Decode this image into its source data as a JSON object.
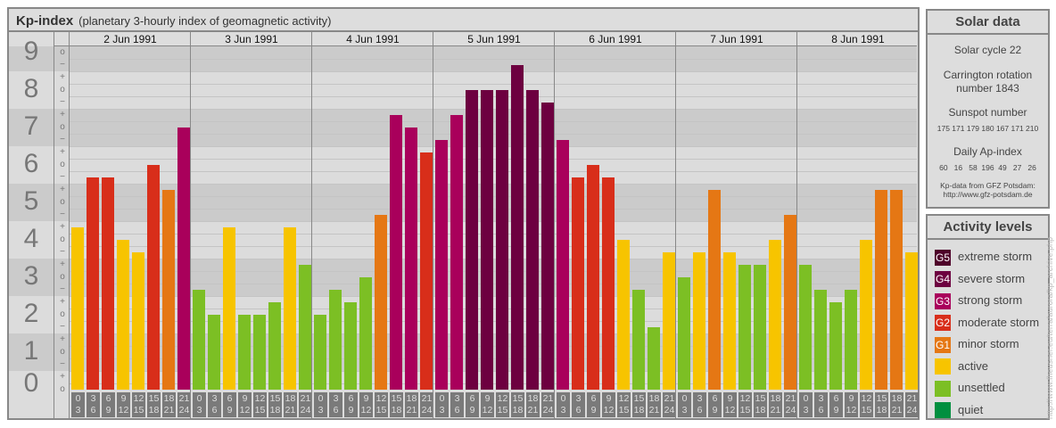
{
  "header": {
    "title": "Kp-index",
    "subtitle": "(planetary 3-hourly index of geomagnetic activity)"
  },
  "chart_data": {
    "type": "bar",
    "title": "Kp-index",
    "ylabel": "Kp",
    "ylim": [
      0,
      9
    ],
    "y_ticks": [
      "0",
      "1",
      "2",
      "3",
      "4",
      "5",
      "6",
      "7",
      "8",
      "9"
    ],
    "sub_marks": [
      "o",
      "+",
      "−"
    ],
    "days": [
      "2 Jun 1991",
      "3 Jun 1991",
      "4 Jun 1991",
      "5 Jun 1991",
      "6 Jun 1991",
      "7 Jun 1991",
      "8 Jun 1991"
    ],
    "hour_labels": [
      [
        "0",
        "3"
      ],
      [
        "3",
        "6"
      ],
      [
        "6",
        "9"
      ],
      [
        "9",
        "12"
      ],
      [
        "12",
        "15"
      ],
      [
        "15",
        "18"
      ],
      [
        "18",
        "21"
      ],
      [
        "21",
        "24"
      ]
    ],
    "values": [
      [
        4.33,
        5.67,
        5.67,
        4.0,
        3.67,
        6.0,
        5.33,
        7.0
      ],
      [
        2.67,
        2.0,
        4.33,
        2.0,
        2.0,
        2.33,
        4.33,
        3.33
      ],
      [
        2.0,
        2.67,
        2.33,
        3.0,
        4.67,
        7.33,
        7.0,
        6.33
      ],
      [
        6.67,
        7.33,
        8.0,
        8.0,
        8.0,
        8.67,
        8.0,
        7.67
      ],
      [
        6.67,
        5.67,
        6.0,
        5.67,
        4.0,
        2.67,
        1.67,
        3.67
      ],
      [
        3.0,
        3.67,
        5.33,
        3.67,
        3.33,
        3.33,
        4.0,
        4.67
      ],
      [
        3.33,
        2.67,
        2.33,
        2.67,
        4.0,
        5.33,
        5.33,
        3.67
      ]
    ]
  },
  "solar": {
    "title": "Solar data",
    "cycle": "Solar cycle 22",
    "carrington": "Carrington rotation number 1843",
    "sunspot_label": "Sunspot number",
    "sunspot_values": "175 171 179 180 167 171 210",
    "ap_label": "Daily Ap-index",
    "ap_values": "60   16   58  196  49   27   26",
    "source": "Kp-data from GFZ Potsdam:",
    "source_url": "http://www.gfz-potsdam.de"
  },
  "legend": {
    "title": "Activity levels",
    "items": [
      {
        "code": "G5",
        "label": "extreme storm",
        "color": "#4e0029"
      },
      {
        "code": "G4",
        "label": "severe storm",
        "color": "#6d0040"
      },
      {
        "code": "G3",
        "label": "strong storm",
        "color": "#a9005b"
      },
      {
        "code": "G2",
        "label": "moderate storm",
        "color": "#d82e1a"
      },
      {
        "code": "G1",
        "label": "minor storm",
        "color": "#e57714"
      },
      {
        "code": "",
        "label": "active",
        "color": "#f7c400"
      },
      {
        "code": "",
        "label": "unsettled",
        "color": "#7cbf24"
      },
      {
        "code": "",
        "label": "quiet",
        "color": "#008f3f"
      }
    ]
  },
  "watermark": "http://www.fheusner.eu/terra/aurora/kp_archive.php"
}
